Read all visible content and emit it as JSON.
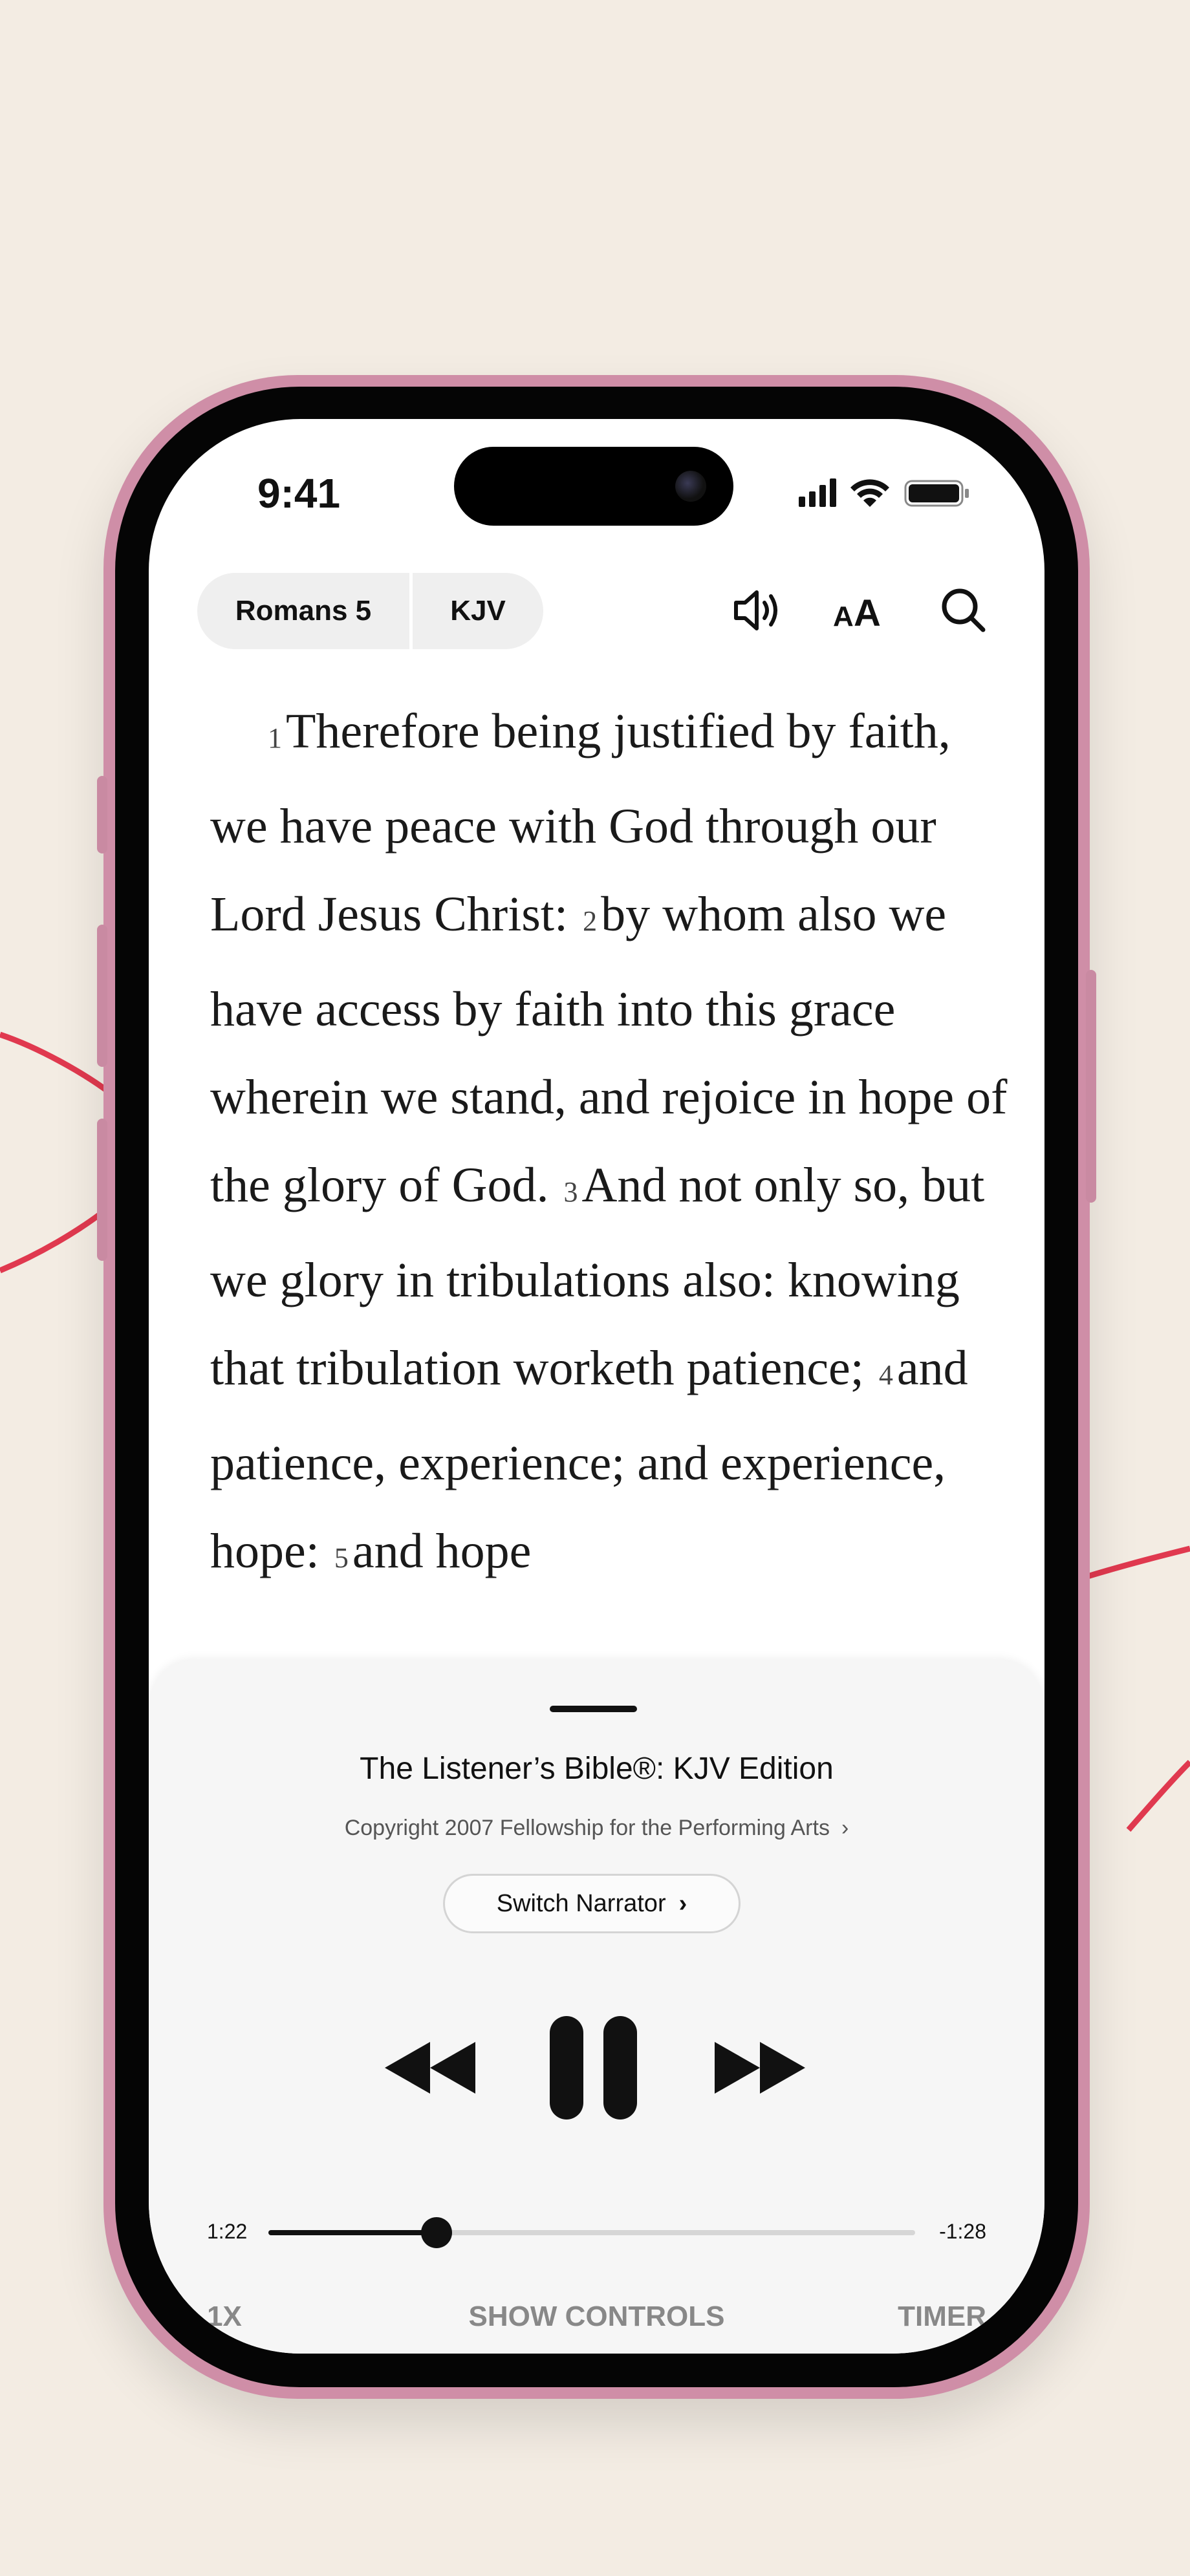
{
  "status_bar": {
    "time": "9:41"
  },
  "toolbar": {
    "book": "Romans 5",
    "version": "KJV",
    "icons": [
      "speaker-icon",
      "text-size-icon",
      "search-icon"
    ]
  },
  "scripture": {
    "verses": [
      {
        "num": "1",
        "text": "Therefore being justified by faith, we have peace with God through our Lord Jesus Christ:"
      },
      {
        "num": "2",
        "text": "by whom also we have access by faith into this grace wherein we stand, and rejoice in hope of the glory of God."
      },
      {
        "num": "3",
        "text": "And not only so, but we glory in tribulations also: knowing that tribulation worketh patience;"
      },
      {
        "num": "4",
        "text": "and patience, experience; and experience, hope:"
      },
      {
        "num": "5",
        "text": "and hope"
      }
    ]
  },
  "player": {
    "title": "The Listener’s Bible®: KJV Edition",
    "copyright": "Copyright 2007 Fellowship for the Performing Arts",
    "switch_narrator": "Switch Narrator",
    "elapsed": "1:22",
    "remaining": "-1:28",
    "progress": 0.26,
    "speed": "1X",
    "show_controls": "SHOW CONTROLS",
    "timer": "TIMER"
  },
  "colors": {
    "background": "#f3ece3",
    "phone_frame": "#cf8ea7",
    "accent_lines": "#e0394f"
  }
}
